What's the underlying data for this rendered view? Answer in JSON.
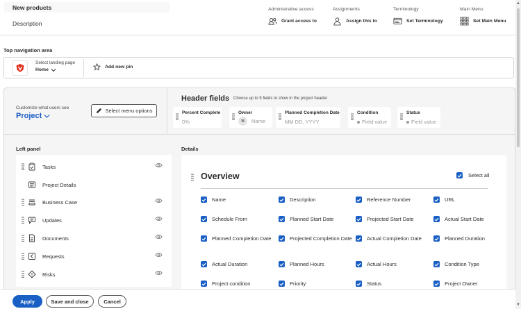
{
  "top": {
    "title": "New products",
    "description_label": "Description",
    "columns": [
      {
        "heading": "Administrative access",
        "action": "Grant access to",
        "icon": "users-icon"
      },
      {
        "heading": "Assignments",
        "action": "Assign this to",
        "icon": "user-icon"
      },
      {
        "heading": "Terminology",
        "action": "Set Terminology",
        "icon": "terminology-icon"
      },
      {
        "heading": "Main Menu",
        "action": "Set Main Menu",
        "icon": "grid-icon"
      }
    ]
  },
  "top_nav": {
    "label": "Top navigation area",
    "landing_label": "Select landing page",
    "landing_value": "Home",
    "add_pin": "Add new pin"
  },
  "customize": {
    "label": "Customize what users see",
    "value": "Project",
    "menu_button": "Select menu options"
  },
  "header_fields": {
    "title": "Header fields",
    "subtitle": "Choose up to 5 fields to show in the project header",
    "cards": [
      {
        "name": "Percent Complete",
        "value": "0%"
      },
      {
        "name": "Owner",
        "avatar": "N",
        "value": "Name"
      },
      {
        "name": "Planned Completion Date",
        "value": "MM DD, YYYY"
      },
      {
        "name": "Condition",
        "value": "Field value"
      },
      {
        "name": "Status",
        "value": "Field value"
      }
    ]
  },
  "left_panel": {
    "title": "Left panel",
    "items": [
      {
        "label": "Tasks",
        "icon": "tasks-icon",
        "visible_toggle": true
      },
      {
        "label": "Project Details",
        "icon": "details-icon",
        "visible_toggle": false
      },
      {
        "label": "Business Case",
        "icon": "business-case-icon",
        "visible_toggle": true
      },
      {
        "label": "Updates",
        "icon": "updates-icon",
        "visible_toggle": true
      },
      {
        "label": "Documents",
        "icon": "documents-icon",
        "visible_toggle": true
      },
      {
        "label": "Requests",
        "icon": "requests-icon",
        "visible_toggle": true
      },
      {
        "label": "Risks",
        "icon": "risks-icon",
        "visible_toggle": true
      }
    ]
  },
  "details": {
    "title": "Details",
    "overview_title": "Overview",
    "select_all": "Select all",
    "fields": [
      [
        "Name",
        "Description",
        "Reference Number",
        "URL"
      ],
      [
        "Schedule From",
        "Planned Start Date",
        "Projected Start Date",
        "Actual Start Date"
      ],
      [
        "Planned Completion Date",
        "Projected Completion Date",
        "Actual Completion Date",
        "Planned Duration"
      ],
      [
        "Actual Duration",
        "Planned Hours",
        "Actual Hours",
        "Condition Type"
      ],
      [
        "Project condition",
        "Priority",
        "Status",
        "Project Owner"
      ]
    ]
  },
  "footer": {
    "apply": "Apply",
    "save_close": "Save and close",
    "cancel": "Cancel"
  },
  "colors": {
    "accent": "#1a5fc4",
    "logo": "#e0301e"
  }
}
